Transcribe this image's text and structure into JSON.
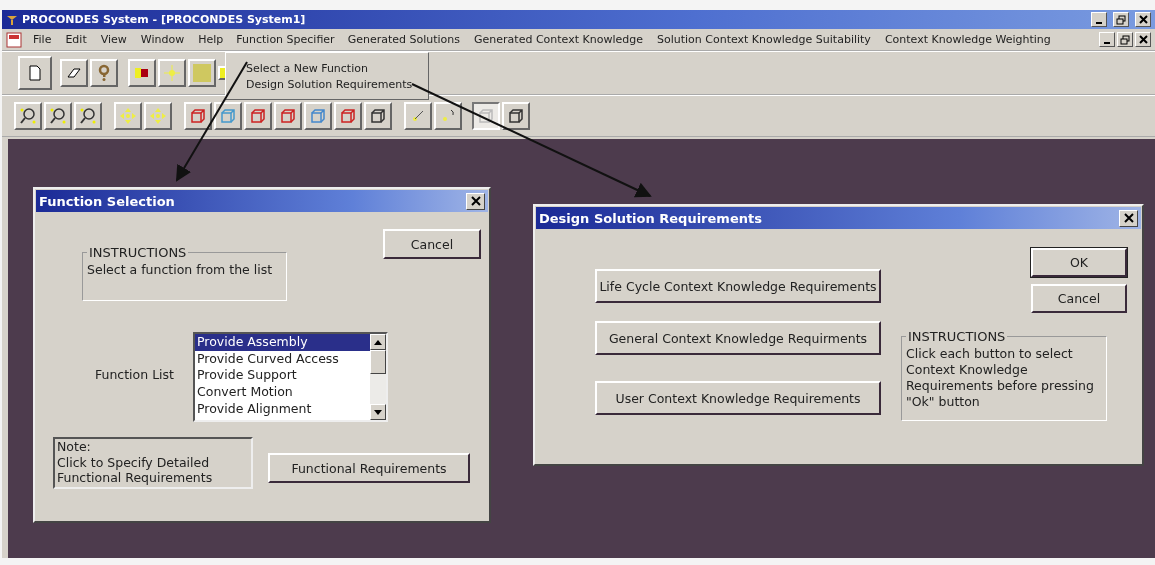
{
  "window": {
    "title": "PROCONDES System - [PROCONDES System1]"
  },
  "menu_bar": {
    "items": [
      {
        "label": "File",
        "selected": false
      },
      {
        "label": "Edit",
        "selected": false
      },
      {
        "label": "View",
        "selected": false
      },
      {
        "label": "Window",
        "selected": false
      },
      {
        "label": "Help",
        "selected": false
      },
      {
        "label": "Function Specifier",
        "selected": true
      },
      {
        "label": "Generated Solutions",
        "selected": false
      },
      {
        "label": "Generated Context Knowledge",
        "selected": false
      },
      {
        "label": "Solution Context Knowledge Suitability",
        "selected": false
      },
      {
        "label": "Context Knowledge Weighting",
        "selected": false
      }
    ]
  },
  "dropdown_menu": {
    "items": [
      "Select a New Function",
      "Design Solution Requirements"
    ]
  },
  "function_selection_dialog": {
    "title": "Function Selection",
    "cancel_button": "Cancel",
    "instructions": {
      "legend": "INSTRUCTIONS",
      "text": "Select a function from the list"
    },
    "list_label": "Function List",
    "list_items": [
      {
        "label": "Provide Assembly",
        "selected": true
      },
      {
        "label": "Provide Curved Access",
        "selected": false
      },
      {
        "label": "Provide Support",
        "selected": false
      },
      {
        "label": "Convert Motion",
        "selected": false
      },
      {
        "label": "Provide Alignment",
        "selected": false
      }
    ],
    "note": [
      "Note:",
      "Click to Specify Detailed",
      "Functional Requirements"
    ],
    "requirements_button": "Functional Requirements"
  },
  "design_requirements_dialog": {
    "title": "Design Solution Requirements",
    "ok_button": "OK",
    "cancel_button": "Cancel",
    "requirement_buttons": [
      "Life Cycle Context Knowledge Requirements",
      "General Context Knowledge Requirments",
      "User Context Knowledge Requirements"
    ],
    "instructions": {
      "legend": "INSTRUCTIONS",
      "text": "Click each button to select Context Knowledge Requirements before pressing \"Ok\" button"
    }
  }
}
